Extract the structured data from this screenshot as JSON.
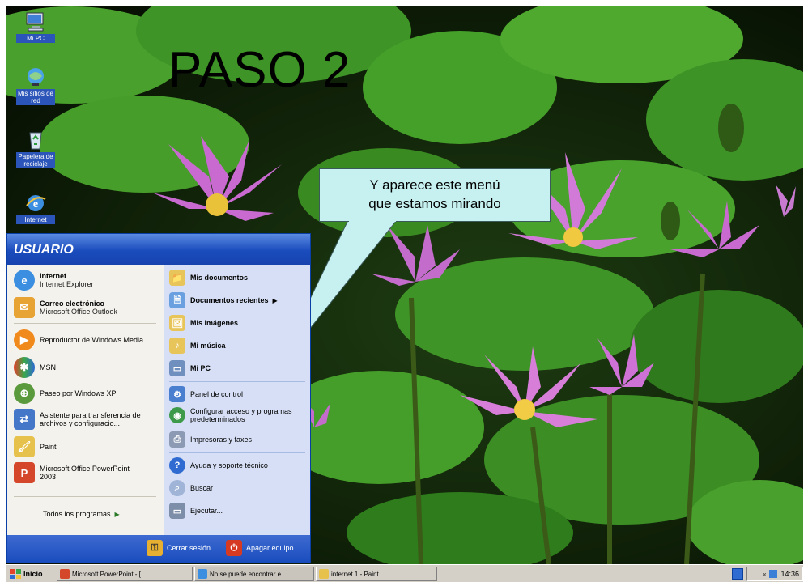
{
  "heading": "PASO 2",
  "callout": {
    "line1": "Y aparece este menú",
    "line2": "que estamos mirando"
  },
  "desktop_icons": [
    {
      "name": "my-computer",
      "label": "Mi PC",
      "icon": "computer-icon"
    },
    {
      "name": "network-places",
      "label": "Mis sitios de red",
      "icon": "network-icon"
    },
    {
      "name": "recycle-bin",
      "label": "Papelera de reciclaje",
      "icon": "recycle-bin-icon"
    },
    {
      "name": "internet",
      "label": "Internet",
      "icon": "internet-explorer-icon"
    }
  ],
  "start_menu": {
    "user": "USUARIO",
    "left_items": [
      {
        "title": "Internet",
        "subtitle": "Internet Explorer",
        "icon": "internet-explorer-icon"
      },
      {
        "title": "Correo electrónico",
        "subtitle": "Microsoft Office Outlook",
        "icon": "outlook-icon"
      },
      {
        "title": "Reproductor de Windows Media",
        "subtitle": "",
        "icon": "media-player-icon"
      },
      {
        "title": "MSN",
        "subtitle": "",
        "icon": "msn-icon"
      },
      {
        "title": "Paseo por Windows XP",
        "subtitle": "",
        "icon": "windows-tour-icon"
      },
      {
        "title": "Asistente para transferencia de archivos y configuracio...",
        "subtitle": "",
        "icon": "transfer-wizard-icon"
      },
      {
        "title": "Paint",
        "subtitle": "",
        "icon": "paint-icon"
      },
      {
        "title": "Microsoft Office PowerPoint 2003",
        "subtitle": "",
        "icon": "powerpoint-icon"
      }
    ],
    "all_programs": "Todos los programas",
    "right_items": [
      {
        "label": "Mis documentos",
        "icon": "my-documents-icon",
        "bold": true
      },
      {
        "label": "Documentos recientes",
        "icon": "recent-documents-icon",
        "bold": true
      },
      {
        "label": "Mis imágenes",
        "icon": "my-pictures-icon",
        "bold": true
      },
      {
        "label": "Mi música",
        "icon": "my-music-icon",
        "bold": true
      },
      {
        "label": "Mi PC",
        "icon": "my-computer-icon",
        "bold": true
      },
      {
        "label": "Panel de control",
        "icon": "control-panel-icon",
        "bold": false
      },
      {
        "label": "Configurar acceso y programas predeterminados",
        "icon": "default-programs-icon",
        "bold": false
      },
      {
        "label": "Impresoras y faxes",
        "icon": "printers-icon",
        "bold": false
      },
      {
        "label": "Ayuda y soporte técnico",
        "icon": "help-icon",
        "bold": false
      },
      {
        "label": "Buscar",
        "icon": "search-icon",
        "bold": false
      },
      {
        "label": "Ejecutar...",
        "icon": "run-icon",
        "bold": false
      }
    ],
    "logoff": "Cerrar sesión",
    "shutdown": "Apagar equipo"
  },
  "taskbar": {
    "start": "Inicio",
    "tasks": [
      {
        "label": "Microsoft PowerPoint - [...",
        "icon": "powerpoint-icon"
      },
      {
        "label": "No se puede encontrar e...",
        "icon": "internet-explorer-icon"
      },
      {
        "label": "internet 1 - Paint",
        "icon": "paint-icon"
      }
    ],
    "clock": "14:36"
  }
}
